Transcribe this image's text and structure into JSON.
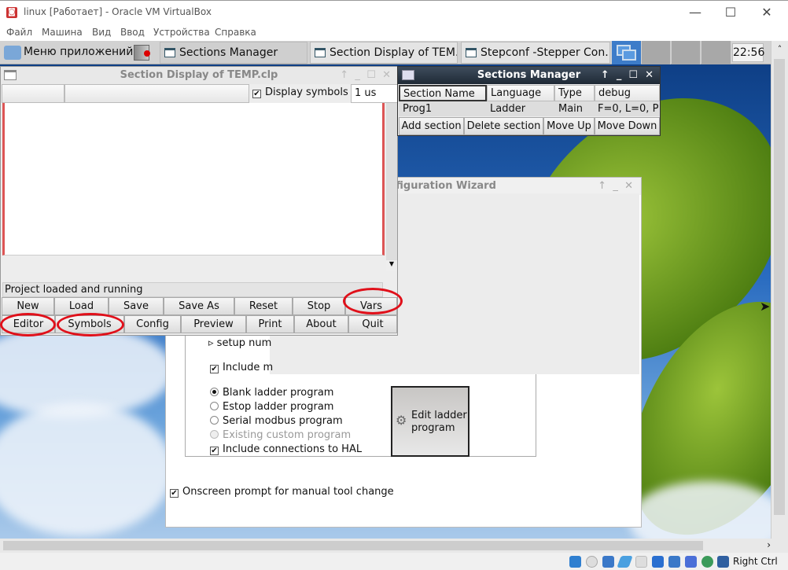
{
  "vbox": {
    "title": "linux [Работает] - Oracle VM VirtualBox",
    "menu": [
      "Файл",
      "Машина",
      "Вид",
      "Ввод",
      "Устройства",
      "Справка"
    ],
    "host_key": "Right Ctrl"
  },
  "taskbar": {
    "app_menu": "Меню приложений",
    "items": [
      "Sections Manager",
      "Section Display of TEM...",
      "Stepconf -Stepper Con..."
    ],
    "active_index": 0,
    "clock": "22:56"
  },
  "section_display": {
    "title": "Section Display of TEMP.clp",
    "display_symbols_label": "Display symbols",
    "display_symbols_checked": true,
    "period": "1 us",
    "status": "Project loaded and running",
    "buttons_row1": [
      "New",
      "Load",
      "Save",
      "Save As",
      "Reset",
      "Stop",
      "Vars"
    ],
    "buttons_row2": [
      "Editor",
      "Symbols",
      "Config",
      "Preview",
      "Print",
      "About",
      "Quit"
    ]
  },
  "sections_manager": {
    "title": "Sections Manager",
    "columns": [
      "Section Name",
      "Language",
      "Type",
      "debug"
    ],
    "rows": [
      [
        "Prog1",
        "Ladder",
        "Main",
        "F=0, L=0, P"
      ]
    ],
    "buttons": [
      "Add section",
      "Delete section",
      "Move Up",
      "Move Down"
    ]
  },
  "stepconf": {
    "title_visible": "nfiguration Wizard",
    "setup_label": "setup num",
    "include_label": "Include m",
    "ladder_options": [
      {
        "label": "Blank ladder program",
        "selected": true,
        "disabled": false
      },
      {
        "label": "Estop ladder program",
        "selected": false,
        "disabled": false
      },
      {
        "label": "Serial modbus program",
        "selected": false,
        "disabled": false
      },
      {
        "label": "Existing custom program",
        "selected": false,
        "disabled": true
      }
    ],
    "include_hal_label": "Include connections to HAL",
    "include_hal_checked": true,
    "edit_ladder_label": "Edit ladder program",
    "manual_tool_label": "Onscreen prompt for manual tool change",
    "manual_tool_checked": true
  },
  "annotations": {
    "highlight_color": "#e0101a",
    "highlighted_buttons": [
      "Vars",
      "Editor",
      "Symbols"
    ]
  }
}
